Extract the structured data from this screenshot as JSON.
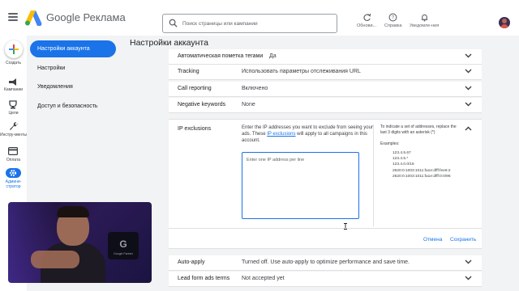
{
  "header": {
    "brand": "Google Реклама",
    "search_placeholder": "Поиск страницы или кампании",
    "actions": [
      {
        "label": "Обнови...",
        "icon": "refresh-icon"
      },
      {
        "label": "Справка",
        "icon": "help-icon"
      },
      {
        "label": "Уведомле-ния",
        "icon": "bell-icon"
      }
    ]
  },
  "rail": {
    "create": "Создать",
    "items": [
      {
        "label": "Кампании",
        "icon": "campaigns-icon"
      },
      {
        "label": "Цели",
        "icon": "goals-icon"
      },
      {
        "label": "Инстру-менты",
        "icon": "tools-icon"
      },
      {
        "label": "Оплата",
        "icon": "billing-icon"
      },
      {
        "label": "Админи-стратор",
        "icon": "admin-gear-icon",
        "selected": true
      }
    ]
  },
  "nav": {
    "items": [
      {
        "label": "Настройки аккаунта",
        "selected": true
      },
      {
        "label": "Настройки"
      },
      {
        "label": "Уведомления"
      },
      {
        "label": "Доступ и безопасность"
      }
    ]
  },
  "page": {
    "title": "Настройки аккаунта",
    "rows_top": [
      {
        "label": "Автоматическая пометка тегами",
        "value": "Да"
      },
      {
        "label": "Tracking",
        "value": "Использовать параметры отслеживания URL"
      },
      {
        "label": "Call reporting",
        "value": "Включено"
      },
      {
        "label": "Negative keywords",
        "value": "None"
      }
    ],
    "ip_exclusions": {
      "label": "IP exclusions",
      "desc_before": "Enter the IP addresses you want to exclude from seeing your ads. These ",
      "desc_link": "IP exclusions",
      "desc_after": " will apply to all campaigns in this account.",
      "input_placeholder": "Enter one IP address per line",
      "help": "To indicate a set of addresses, replace the last 3 digits with an asterisk (*)",
      "examples_label": "Examples:",
      "examples": [
        "123.4.5.67",
        "123.4.5.*",
        "123.4.0.0/16",
        "2620:0:1003:1011:fa1e:dfff:fee6:2",
        "2620:0:1003:1011:fa1e:dfff:0:0/96"
      ],
      "cancel": "Отмена",
      "save": "Сохранить"
    },
    "rows_bottom": [
      {
        "label": "Auto-apply",
        "value": "Turned off. Use auto-apply to optimize performance and save time."
      },
      {
        "label": "Lead form ads terms",
        "value": "Not accepted yet"
      }
    ]
  },
  "video": {
    "stand_text": "Google Partner"
  },
  "colors": {
    "accent": "#1a73e8",
    "background": "#f1f3f4",
    "create_plus": [
      "#ea4335",
      "#fbbc04",
      "#34a853",
      "#4285f4"
    ]
  }
}
